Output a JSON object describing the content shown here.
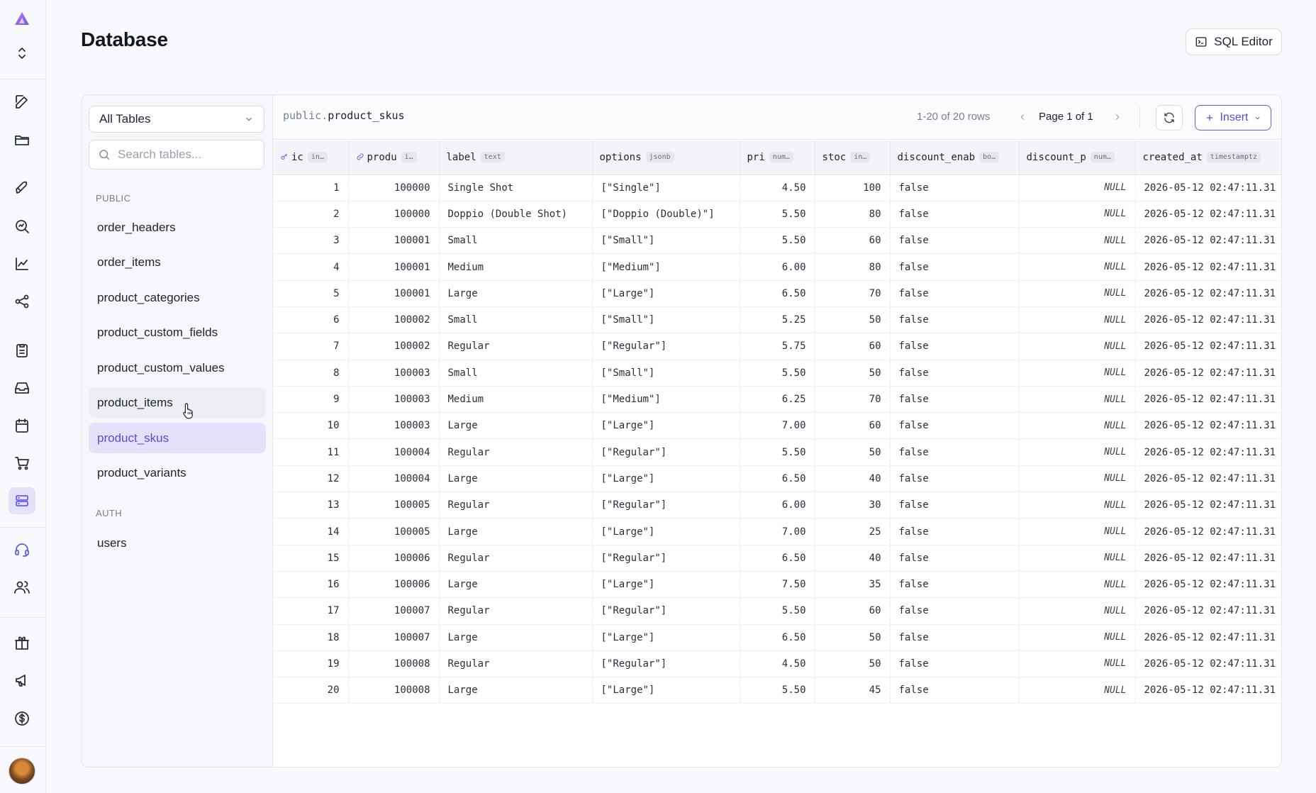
{
  "page": {
    "title": "Database"
  },
  "header": {
    "sql_editor_label": "SQL Editor"
  },
  "rail": {
    "icons": [
      "logo-icon",
      "switch-project-icon",
      "edit-icon",
      "folder-icon",
      "rocket-icon",
      "search-analytics-icon",
      "chart-icon",
      "share-icon",
      "clipboard-icon",
      "inbox-icon",
      "calendar-icon",
      "cart-icon",
      "database-icon",
      "headset-icon",
      "users-icon",
      "gift-icon",
      "megaphone-icon",
      "dollar-icon"
    ],
    "active": "database-icon"
  },
  "sidebar": {
    "filter_value": "All Tables",
    "search_placeholder": "Search tables...",
    "sections": [
      {
        "label": "PUBLIC",
        "items": [
          "order_headers",
          "order_items",
          "product_categories",
          "product_custom_fields",
          "product_custom_values",
          "product_items",
          "product_skus",
          "product_variants"
        ]
      },
      {
        "label": "AUTH",
        "items": [
          "users"
        ]
      }
    ],
    "hovered": "product_items",
    "selected": "product_skus"
  },
  "toolbar": {
    "schema": "public",
    "table": "product_skus",
    "rows_info": "1-20 of 20 rows",
    "page_label": "Page 1 of 1",
    "insert_label": "Insert"
  },
  "columns": [
    {
      "name": "ic",
      "type": "in…",
      "icon": "key-icon"
    },
    {
      "name": "produ",
      "type": "i…",
      "icon": "link-icon"
    },
    {
      "name": "label",
      "type": "text"
    },
    {
      "name": "options",
      "type": "jsonb"
    },
    {
      "name": "pri",
      "type": "num…"
    },
    {
      "name": "stoc",
      "type": "in…"
    },
    {
      "name": "discount_enab",
      "type": "bo…"
    },
    {
      "name": "discount_p",
      "type": "num…"
    },
    {
      "name": "created_at",
      "type": "timestamptz"
    }
  ],
  "rows": [
    [
      "1",
      "100000",
      "Single Shot",
      "[\"Single\"]",
      "4.50",
      "100",
      "false",
      "NULL",
      "2026-05-12 02:47:11.31"
    ],
    [
      "2",
      "100000",
      "Doppio (Double Shot)",
      "[\"Doppio (Double)\"]",
      "5.50",
      "80",
      "false",
      "NULL",
      "2026-05-12 02:47:11.31"
    ],
    [
      "3",
      "100001",
      "Small",
      "[\"Small\"]",
      "5.50",
      "60",
      "false",
      "NULL",
      "2026-05-12 02:47:11.31"
    ],
    [
      "4",
      "100001",
      "Medium",
      "[\"Medium\"]",
      "6.00",
      "80",
      "false",
      "NULL",
      "2026-05-12 02:47:11.31"
    ],
    [
      "5",
      "100001",
      "Large",
      "[\"Large\"]",
      "6.50",
      "70",
      "false",
      "NULL",
      "2026-05-12 02:47:11.31"
    ],
    [
      "6",
      "100002",
      "Small",
      "[\"Small\"]",
      "5.25",
      "50",
      "false",
      "NULL",
      "2026-05-12 02:47:11.31"
    ],
    [
      "7",
      "100002",
      "Regular",
      "[\"Regular\"]",
      "5.75",
      "60",
      "false",
      "NULL",
      "2026-05-12 02:47:11.31"
    ],
    [
      "8",
      "100003",
      "Small",
      "[\"Small\"]",
      "5.50",
      "50",
      "false",
      "NULL",
      "2026-05-12 02:47:11.31"
    ],
    [
      "9",
      "100003",
      "Medium",
      "[\"Medium\"]",
      "6.25",
      "70",
      "false",
      "NULL",
      "2026-05-12 02:47:11.31"
    ],
    [
      "10",
      "100003",
      "Large",
      "[\"Large\"]",
      "7.00",
      "60",
      "false",
      "NULL",
      "2026-05-12 02:47:11.31"
    ],
    [
      "11",
      "100004",
      "Regular",
      "[\"Regular\"]",
      "5.50",
      "50",
      "false",
      "NULL",
      "2026-05-12 02:47:11.31"
    ],
    [
      "12",
      "100004",
      "Large",
      "[\"Large\"]",
      "6.50",
      "40",
      "false",
      "NULL",
      "2026-05-12 02:47:11.31"
    ],
    [
      "13",
      "100005",
      "Regular",
      "[\"Regular\"]",
      "6.00",
      "30",
      "false",
      "NULL",
      "2026-05-12 02:47:11.31"
    ],
    [
      "14",
      "100005",
      "Large",
      "[\"Large\"]",
      "7.00",
      "25",
      "false",
      "NULL",
      "2026-05-12 02:47:11.31"
    ],
    [
      "15",
      "100006",
      "Regular",
      "[\"Regular\"]",
      "6.50",
      "40",
      "false",
      "NULL",
      "2026-05-12 02:47:11.31"
    ],
    [
      "16",
      "100006",
      "Large",
      "[\"Large\"]",
      "7.50",
      "35",
      "false",
      "NULL",
      "2026-05-12 02:47:11.31"
    ],
    [
      "17",
      "100007",
      "Regular",
      "[\"Regular\"]",
      "5.50",
      "60",
      "false",
      "NULL",
      "2026-05-12 02:47:11.31"
    ],
    [
      "18",
      "100007",
      "Large",
      "[\"Large\"]",
      "6.50",
      "50",
      "false",
      "NULL",
      "2026-05-12 02:47:11.31"
    ],
    [
      "19",
      "100008",
      "Regular",
      "[\"Regular\"]",
      "4.50",
      "50",
      "false",
      "NULL",
      "2026-05-12 02:47:11.31"
    ],
    [
      "20",
      "100008",
      "Large",
      "[\"Large\"]",
      "5.50",
      "45",
      "false",
      "NULL",
      "2026-05-12 02:47:11.31"
    ]
  ],
  "colors": {
    "accent": "#6b5ce7",
    "selected_bg": "#e4e1fb"
  }
}
